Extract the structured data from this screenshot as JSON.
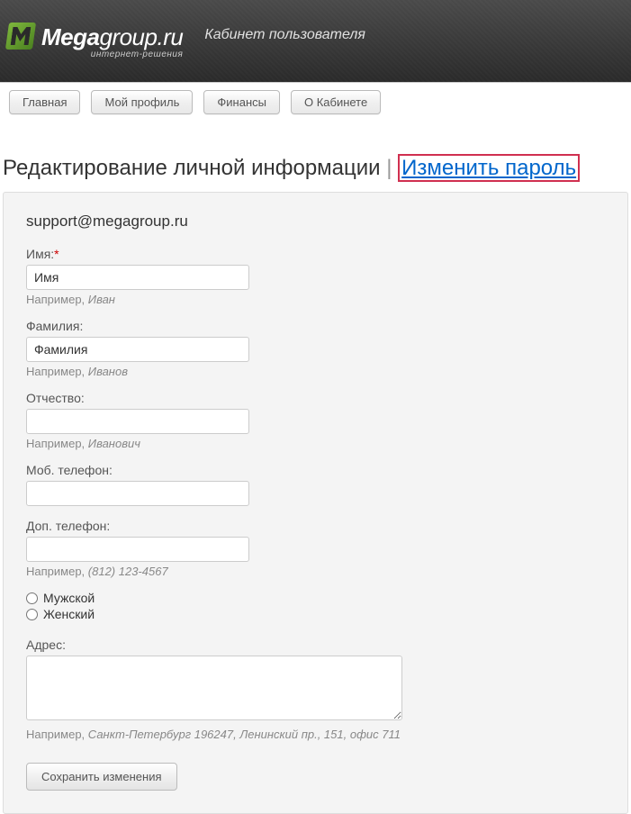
{
  "header": {
    "logo_main": "Mega",
    "logo_rest": "group.ru",
    "logo_subtitle": "интернет-решения",
    "tagline": "Кабинет пользователя"
  },
  "nav": {
    "items": [
      {
        "label": "Главная"
      },
      {
        "label": "Мой профиль"
      },
      {
        "label": "Финансы"
      },
      {
        "label": "О Кабинете"
      }
    ]
  },
  "page": {
    "title": "Редактирование личной информации",
    "separator": "|",
    "change_password": "Изменить пароль"
  },
  "form": {
    "email": "support@megagroup.ru",
    "first_name": {
      "label": "Имя:",
      "value": "Имя",
      "hint_prefix": "Например, ",
      "hint_example": "Иван"
    },
    "last_name": {
      "label": "Фамилия:",
      "value": "Фамилия",
      "hint_prefix": "Например, ",
      "hint_example": "Иванов"
    },
    "patronymic": {
      "label": "Отчество:",
      "value": "",
      "hint_prefix": "Например, ",
      "hint_example": "Иванович"
    },
    "mobile_phone": {
      "label": "Моб. телефон:",
      "value": ""
    },
    "additional_phone": {
      "label": "Доп. телефон:",
      "value": "",
      "hint_prefix": "Например, ",
      "hint_example": "(812) 123-4567"
    },
    "gender": {
      "male": "Мужской",
      "female": "Женский"
    },
    "address": {
      "label": "Адрес:",
      "value": "",
      "hint_prefix": "Например, ",
      "hint_example": "Санкт-Петербург 196247, Ленинский пр., 151, офис 711"
    },
    "submit": "Сохранить изменения"
  }
}
